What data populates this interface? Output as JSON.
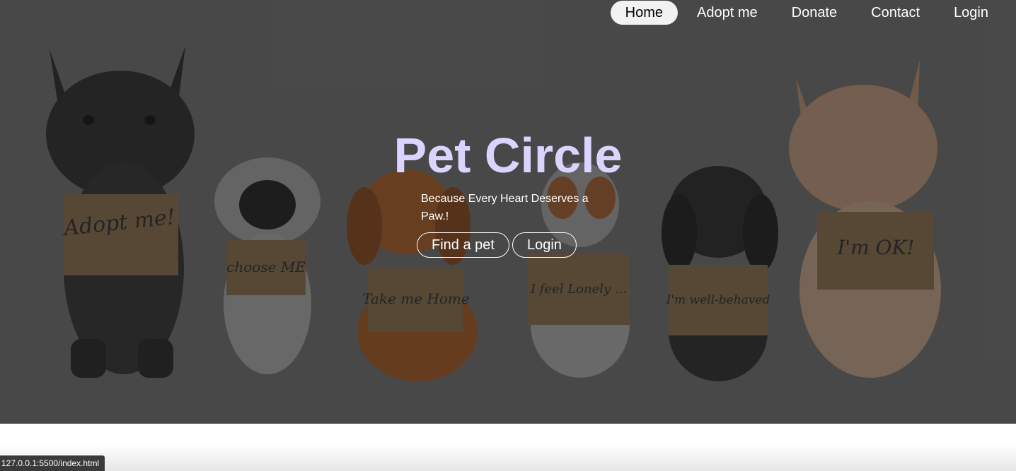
{
  "nav": {
    "items": [
      {
        "label": "Home"
      },
      {
        "label": "Adopt me"
      },
      {
        "label": "Donate"
      },
      {
        "label": "Contact"
      },
      {
        "label": "Login"
      }
    ]
  },
  "hero": {
    "title": "Pet Circle",
    "tagline": "Because Every Heart Deserves a Paw.!",
    "buttons": {
      "find": "Find a pet",
      "login": "Login"
    },
    "image": {
      "signs": [
        "Adopt me!",
        "choose ME",
        "Take me Home",
        "I feel Lonely ...",
        "I'm well-behaved",
        "I'm OK!"
      ]
    }
  },
  "status_bar": {
    "url": "127.0.0.1:5500/index.html"
  },
  "colors": {
    "hero_overlay": "#4b4b4b",
    "title": "#dcd4ff",
    "active_nav": "#f2f2f2"
  }
}
